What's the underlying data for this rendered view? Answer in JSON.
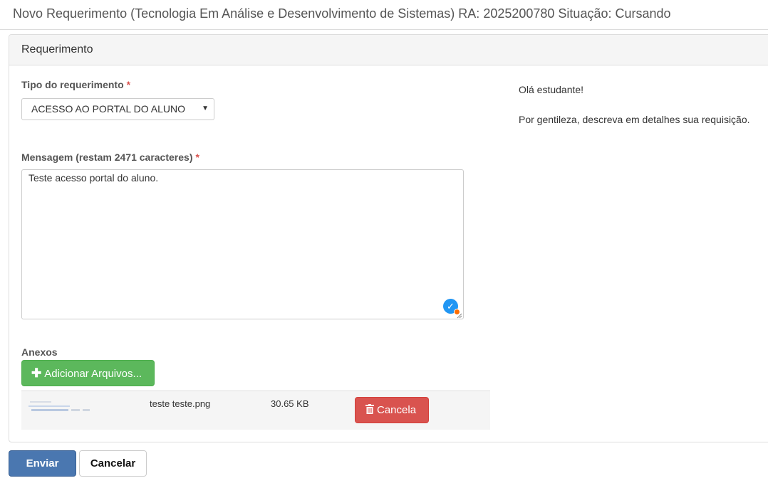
{
  "header": {
    "title": "Novo Requerimento (Tecnologia Em Análise e Desenvolvimento de Sistemas) RA: 2025200780 Situação: Cursando"
  },
  "panel": {
    "heading": "Requerimento"
  },
  "form": {
    "tipo_label": "Tipo do requerimento",
    "required_mark": "*",
    "tipo_value": "ACESSO AO PORTAL DO ALUNO",
    "mensagem_label": "Mensagem (restam 2471 caracteres)",
    "mensagem_value": "Teste acesso portal do aluno.",
    "anexos_label": "Anexos",
    "add_files_label": "Adicionar Arquivos...",
    "files": [
      {
        "name": "teste teste.png",
        "size": "30.65 KB",
        "cancel_label": "Cancela"
      }
    ]
  },
  "side": {
    "greeting": "Olá estudante!",
    "instruction": "Por gentileza, descreva em detalhes sua requisição."
  },
  "footer": {
    "submit_label": "Enviar",
    "cancel_label": "Cancelar"
  },
  "colors": {
    "success": "#5cb85c",
    "danger": "#d9534f",
    "primary": "#4a77b0",
    "required": "#d9534f"
  },
  "icons": {
    "add": "plus-icon",
    "delete": "trash-icon",
    "dropdown": "caret-down-icon",
    "grammar": "checkmark-badge-icon"
  }
}
